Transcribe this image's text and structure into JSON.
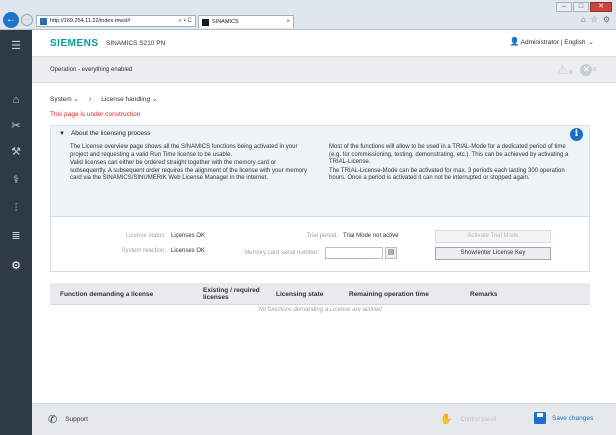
{
  "browser": {
    "url": "http://169.254.11.22/index.mwsl#",
    "address_icons": "⌕ ▾ C",
    "tab_title": "SINAMICS",
    "tab_close": "×",
    "right_icons": [
      "⌂",
      "☆",
      "⚙"
    ],
    "window_controls": [
      "–",
      "□",
      "✕"
    ]
  },
  "header": {
    "logo": "SIEMENS",
    "device": "SINAMICS S210 PN",
    "user": "Administrator | English"
  },
  "status": {
    "text": "Operation - everything enabled",
    "warnings": "0",
    "errors": "0"
  },
  "breadcrumb": {
    "system": "System",
    "license": "License handling"
  },
  "construction": "This page is under construction",
  "info": {
    "title": "About the licensing process",
    "left_p1": "The License overview page shows all the SINAMICS functions being activated in your project and requesting a valid Run Time license to be usable.",
    "left_p2": "Valid licenses can either be ordered straight together with the memory card or subsequently. A subsequent order requires the alignment of the license with your memory card via the SINAMICS/SINUMERIK Web License Manager in the internet.",
    "right_p1": "Most of the functions will allow to be used in a TRIAL-Mode for a dedicated period of time (e.g. for commissioning, testing, demonstrating, etc.). This can be achieved by activating a TRIAL-License.",
    "right_p2": "The TRIAL-License-Mode can be activated for max. 3 periods each lasting 300 operation hours. Once a period is activated it can not be interrupted or stopped again."
  },
  "license": {
    "status_label": "License status:",
    "status_value": "Licenses OK",
    "reaction_label": "System reaction:",
    "reaction_value": "Licenses OK",
    "trial_label": "Trial period:",
    "trial_value": "Trial Mode not active",
    "serial_label": "Memory card serial number:",
    "serial_value": "",
    "activate_btn": "Activate Trial Mode",
    "show_btn": "Show/enter License Key"
  },
  "table": {
    "columns": [
      "Function demanding a license",
      "Existing / required licenses",
      "Licensing state",
      "Remaining operation time",
      "Remarks"
    ],
    "empty": "No functions demanding a License are actived"
  },
  "footer": {
    "support": "Support",
    "control_panel": "Control panel",
    "save": "Save changes"
  },
  "colors": {
    "brand": "#009999",
    "sidebar": "#2f3a47",
    "accent": "#1a6fc7",
    "warning_text": "#d9261c"
  }
}
